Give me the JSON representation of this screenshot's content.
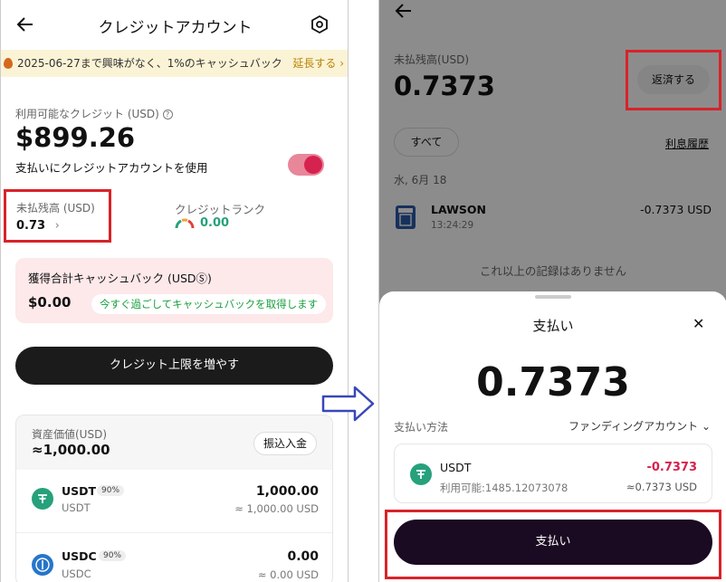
{
  "left": {
    "title": "クレジットアカウント",
    "banner": {
      "text": "2025-06-27まで興味がなく、1%のキャッシュバック",
      "extend": "延長する ›"
    },
    "available": {
      "label": "利用可能なクレジット (USD)",
      "amount": "$899.26",
      "use_label": "支払いにクレジットアカウントを使用"
    },
    "unpaid": {
      "label": "未払残高 (USD)",
      "value": "0.73",
      "chevron": "›"
    },
    "rank": {
      "label": "クレジットランク",
      "value": "0.00"
    },
    "cashback": {
      "title": "獲得合計キャッシュバック (USDⓈ)",
      "amount": "$0.00",
      "pill": "今すぐ過ごしてキャッシュバックを取得します"
    },
    "increase_btn": "クレジット上限を増やす",
    "assets": {
      "label": "資産価値(USD)",
      "total": "≈1,000.00",
      "deposit_btn": "振込入金",
      "rows": [
        {
          "symbol": "USDT",
          "name": "USDT",
          "badge": "90%",
          "amount": "1,000.00",
          "usd": "≈ 1,000.00 USD"
        },
        {
          "symbol": "USDC",
          "name": "USDC",
          "badge": "90%",
          "amount": "0.00",
          "usd": "≈ 0.00 USD"
        }
      ]
    }
  },
  "right": {
    "unpaid": {
      "label": "未払残高(USD)",
      "value": "0.7373",
      "repay_btn": "返済する"
    },
    "filter_all": "すべて",
    "interest_link": "利息履歴",
    "date": "水, 6月 18",
    "tx": {
      "merchant": "LAWSON",
      "time": "13:24:29",
      "amount": "-0.7373 USD"
    },
    "no_more": "これ以上の記録はありません",
    "sheet": {
      "title": "支払い",
      "close": "✕",
      "amount": "0.7373",
      "method_label": "支払い方法",
      "method_value": "ファンディングアカウント ⌄",
      "coin": {
        "name": "USDT",
        "available": "利用可能:1485.12073078",
        "amount": "-0.7373",
        "usd": "≈0.7373 USD"
      },
      "pay_btn": "支払い"
    }
  },
  "colors": {
    "highlight": "#d8232a",
    "teal": "#26a17b",
    "arrow": "#3848b8",
    "pay_btn": "#1a0a22"
  }
}
